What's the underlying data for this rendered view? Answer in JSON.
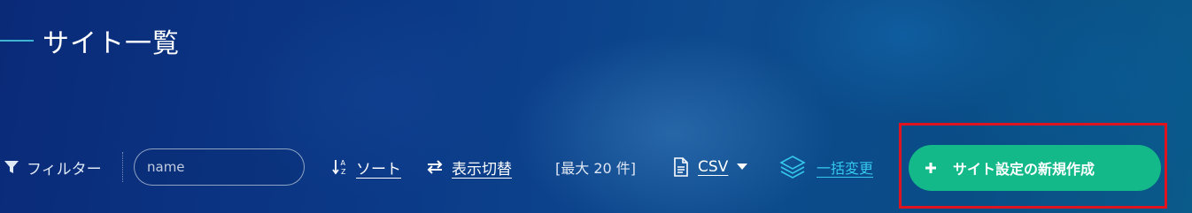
{
  "page": {
    "title": "サイト一覧"
  },
  "toolbar": {
    "filter_label": "フィルター",
    "search_placeholder": "name",
    "search_value": "",
    "sort_label": "ソート",
    "view_toggle_label": "表示切替",
    "max_label": "[最大 20 件]",
    "csv_label": "CSV",
    "bulk_edit_label": "一括変更",
    "create_button_label": "サイト設定の新規作成"
  },
  "icons": {
    "filter": "filter-icon",
    "sort": "sort-az-icon",
    "view_toggle": "swap-arrows-icon",
    "csv": "document-icon",
    "csv_menu": "caret-down-icon",
    "bulk_edit": "layers-icon",
    "create": "plus-icon"
  },
  "colors": {
    "accent_line": "#3fb5d6",
    "bulk_link": "#35c8ee",
    "create_button": "#14b98a",
    "highlight_border": "#e0141e"
  }
}
